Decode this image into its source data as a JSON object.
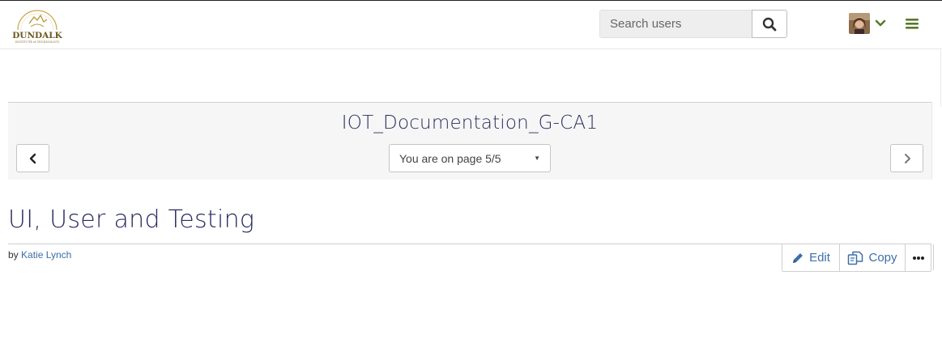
{
  "header": {
    "logo_text": "DUNDALK",
    "logo_subtext": "INSTITUTE of TECHNOLOGY",
    "search_placeholder": "Search users",
    "search_icon": "search-icon",
    "menu_icon": "hamburger-menu-icon",
    "accent_color": "#5a7a2a"
  },
  "collection": {
    "title": "IOT_Documentation_G-CA1",
    "page_select_label": "You are on page 5/5",
    "prev_icon": "chevron-left-icon",
    "next_icon": "chevron-right-icon"
  },
  "page": {
    "title": "UI, User and Testing",
    "by_prefix": "by",
    "author": "Katie Lynch"
  },
  "actions": {
    "edit_label": "Edit",
    "copy_label": "Copy",
    "more_icon": "more-options-icon",
    "link_color": "#3d6fa8"
  }
}
